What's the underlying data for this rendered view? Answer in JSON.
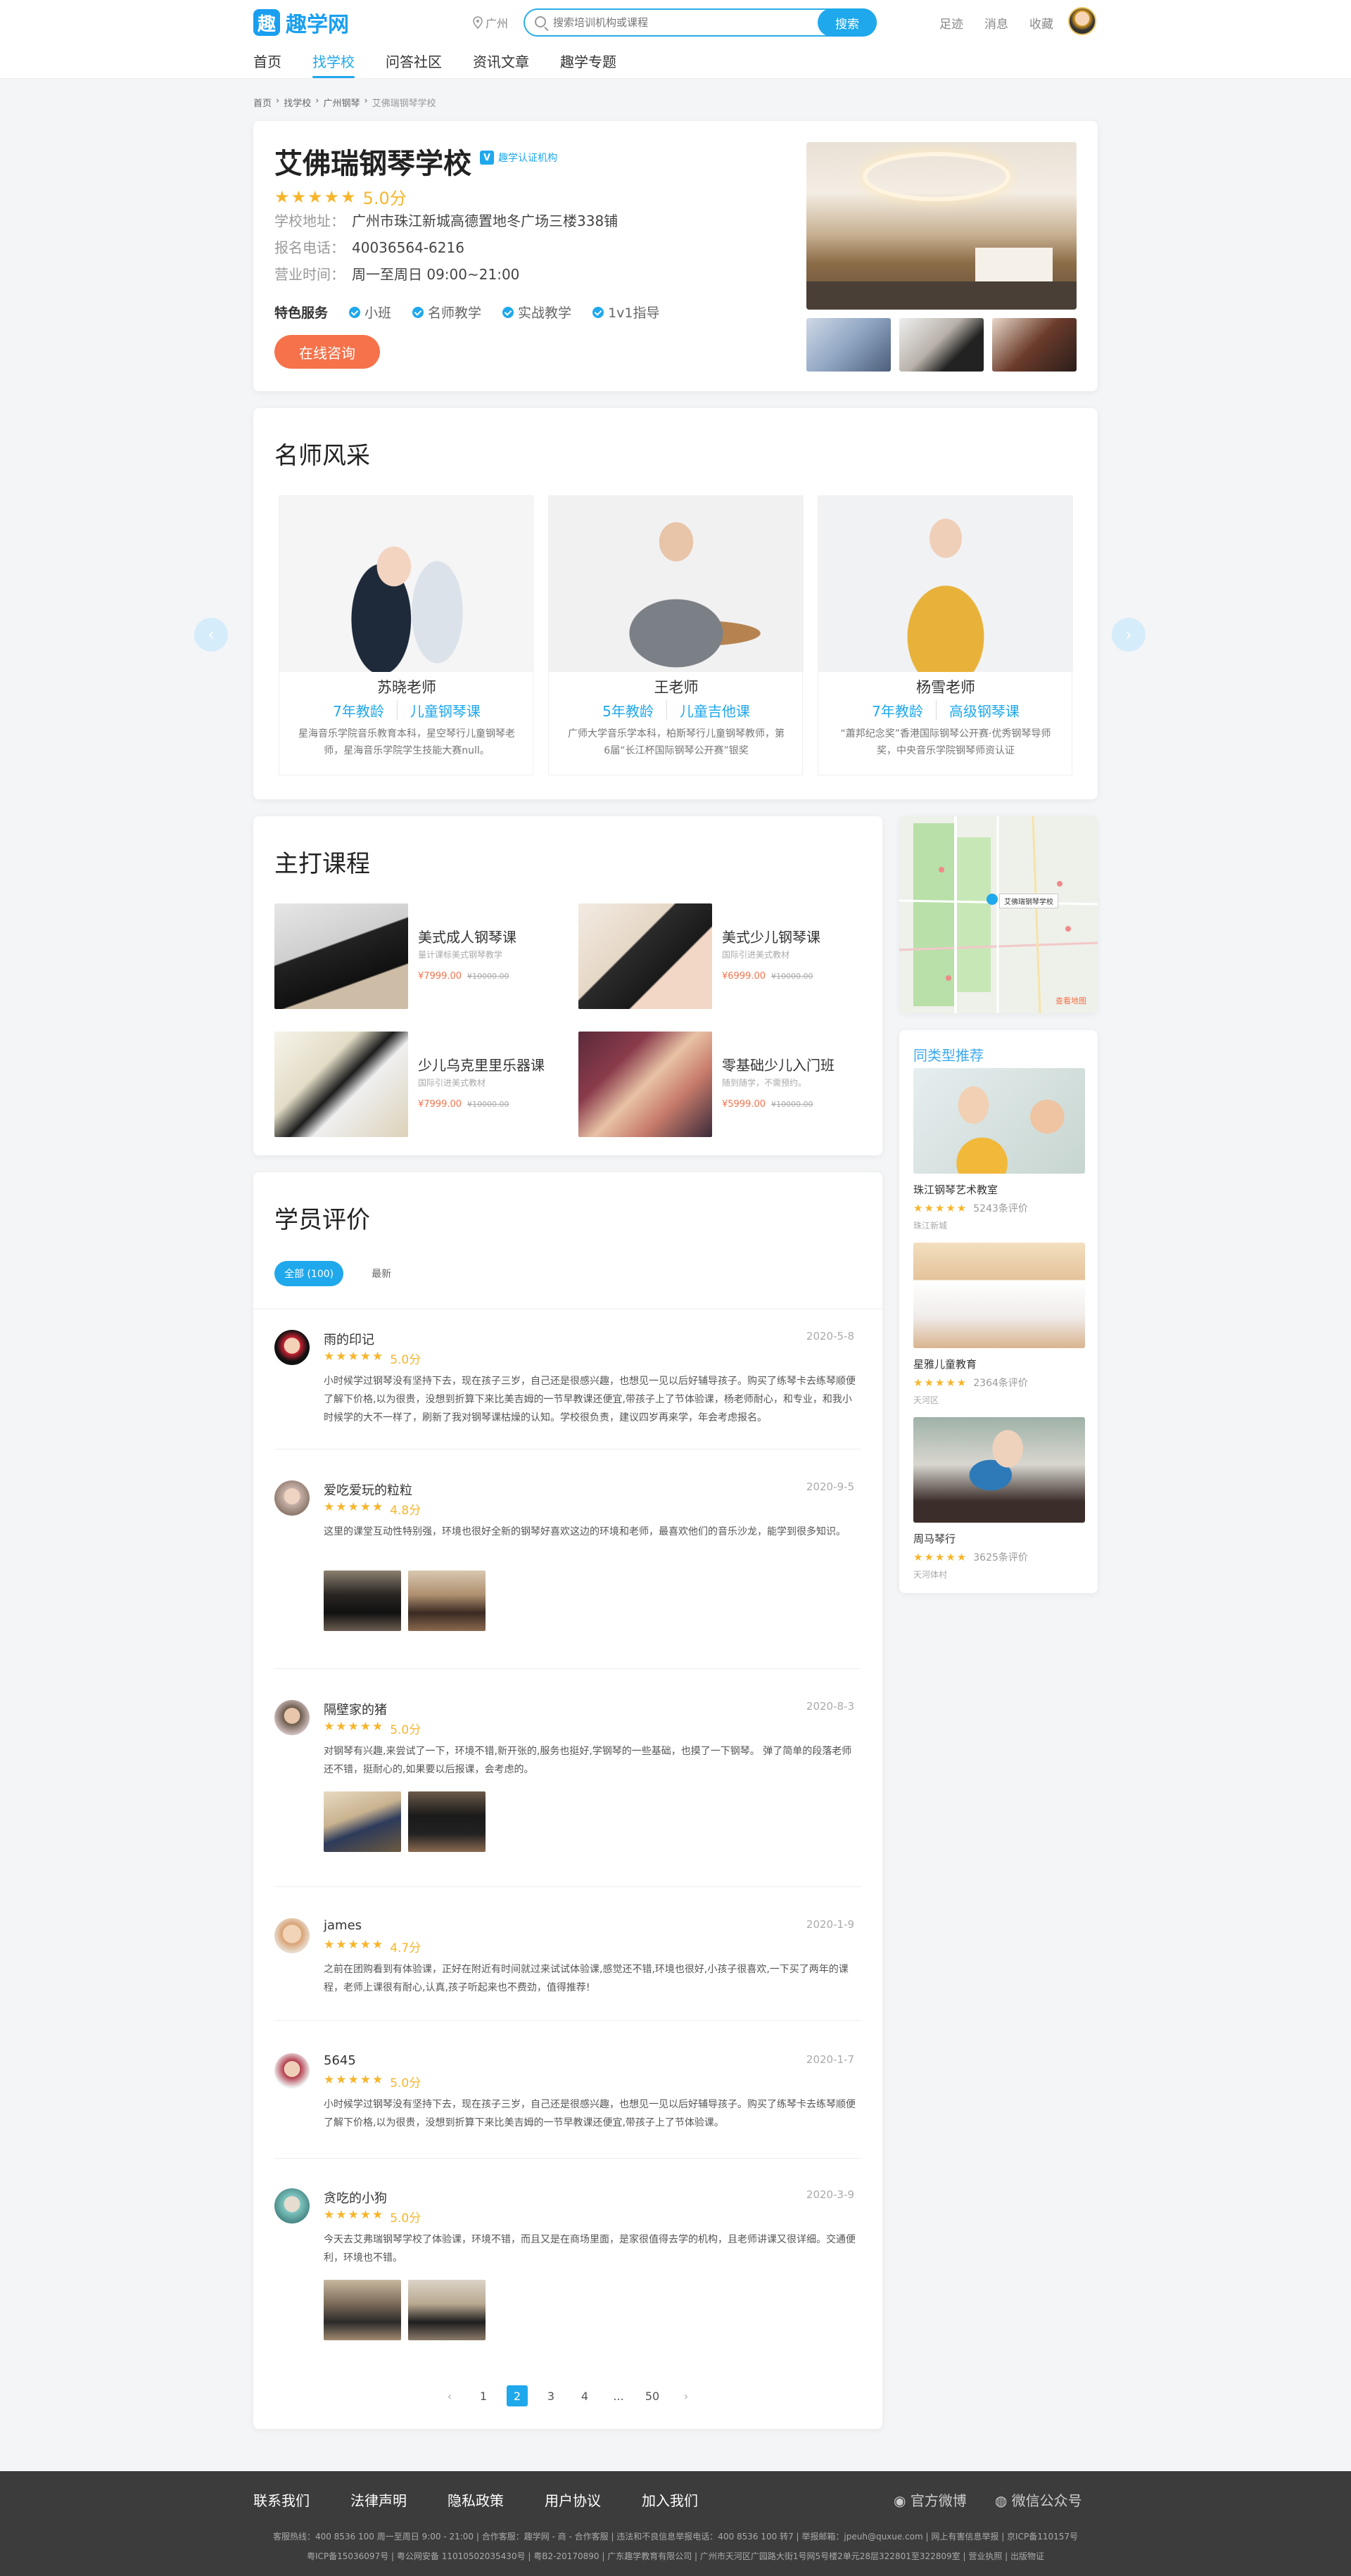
{
  "header": {
    "logo_icon": "趣",
    "logo": "趣学网",
    "city": "广州",
    "search_placeholder": "搜索培训机构或课程",
    "search_btn": "搜索",
    "links": [
      "足迹",
      "消息",
      "收藏"
    ],
    "nav": [
      "首页",
      "找学校",
      "问答社区",
      "资讯文章",
      "趣学专题"
    ]
  },
  "breadcrumb": [
    "首页",
    "找学校",
    "广州钢琴",
    "艾佛瑞钢琴学校"
  ],
  "school": {
    "name": "艾佛瑞钢琴学校",
    "verify_badge": "V",
    "verify": "趣学认证机构",
    "stars": "★★★★★",
    "score": "5.0分",
    "address_label": "学校地址：",
    "address": "广州市珠江新城高德置地冬广场三楼338铺",
    "phone_label": "报名电话：",
    "phone": "40036564-6216",
    "hours_label": "营业时间：",
    "hours": "周一至周日 09:00~21:00",
    "features_label": "特色服务",
    "features": [
      "小班",
      "名师教学",
      "实战教学",
      "1v1指导"
    ],
    "consult": "在线咨询"
  },
  "teachers": {
    "title": "名师风采",
    "items": [
      {
        "name": "苏晓老师",
        "years": "7年教龄",
        "subject": "儿童钢琴课",
        "desc": "星海音乐学院音乐教育本科，星空琴行儿童钢琴老师，星海音乐学院学生技能大赛null。"
      },
      {
        "name": "王老师",
        "years": "5年教龄",
        "subject": "儿童吉他课",
        "desc": "广师大学音乐学本科，柏斯琴行儿童钢琴教师，第6届“长江杯国际钢琴公开赛”银奖"
      },
      {
        "name": "杨雪老师",
        "years": "7年教龄",
        "subject": "高级钢琴课",
        "desc": "“蕭邦纪念奖”香港国际钢琴公开赛·优秀钢琴导师奖，中央音乐学院钢琴师资认证"
      }
    ]
  },
  "courses": {
    "title": "主打课程",
    "items": [
      {
        "title": "美式成人钢琴课",
        "sub": "量计课标美式钢琴教学",
        "price": "¥7999.00",
        "old": "¥10000.00"
      },
      {
        "title": "美式少儿钢琴课",
        "sub": "国际引进美式教材",
        "price": "¥6999.00",
        "old": "¥10000.00"
      },
      {
        "title": "少儿乌克里里乐器课",
        "sub": "国际引进美式教材",
        "price": "¥7999.00",
        "old": "¥10000.00"
      },
      {
        "title": "零基础少儿入门班",
        "sub": "随到随学，不需预约。",
        "price": "¥5999.00",
        "old": "¥10000.00"
      }
    ]
  },
  "map": {
    "label": "艾佛瑞钢琴学校",
    "link": "查看地图"
  },
  "similar": {
    "title": "同类型推荐",
    "items": [
      {
        "name": "珠江钢琴艺术教室",
        "stars": "★★★★★",
        "count": "5243条评价",
        "loc": "珠江新城"
      },
      {
        "name": "星雅儿童教育",
        "stars": "★★★★★",
        "count": "2364条评价",
        "loc": "天河区"
      },
      {
        "name": "周马琴行",
        "stars": "★★★★★",
        "count": "3625条评价",
        "loc": "天河体村"
      }
    ]
  },
  "reviews": {
    "title": "学员评价",
    "tab_all": "全部 (100)",
    "tab_new": "最新",
    "items": [
      {
        "name": "雨的印记",
        "date": "2020-5-8",
        "stars": "★★★★★",
        "score": "5.0分",
        "text": "小时候学过钢琴没有坚持下去，现在孩子三岁，自己还是很感兴趣，也想见一见以后好辅导孩子。购买了练琴卡去练琴顺便了解下价格,以为很贵，没想到折算下来比美吉姆的一节早教课还便宜,带孩子上了节体验课，杨老师耐心，和专业，和我小时候学的大不一样了，刷新了我对钢琴课枯燥的认知。学校很负责，建议四岁再来学，年会考虑报名。"
      },
      {
        "name": "爱吃爱玩的粒粒",
        "date": "2020-9-5",
        "stars": "★★★★★",
        "score": "4.8分",
        "text": "这里的课堂互动性特别强，环境也很好全新的钢琴好喜欢这边的环境和老师，最喜欢他们的音乐沙龙，能学到很多知识。"
      },
      {
        "name": "隔壁家的猪",
        "date": "2020-8-3",
        "stars": "★★★★★",
        "score": "5.0分",
        "text": "对钢琴有兴趣,来尝试了一下，环境不错,新开张的,服务也挺好,学钢琴的一些基础，也摸了一下钢琴。   弹了简单的段落老师还不错，挺耐心的,如果要以后报课，会考虑的。"
      },
      {
        "name": "james",
        "date": "2020-1-9",
        "stars": "★★★★★",
        "score": "4.7分",
        "text": "之前在团购看到有体验课，正好在附近有时间就过来试试体验课,感觉还不错,环境也很好,小孩子很喜欢,一下买了两年的课程，老师上课很有耐心,认真,孩子听起来也不费劲，值得推荐!"
      },
      {
        "name": "5645",
        "date": "2020-1-7",
        "stars": "★★★★★",
        "score": "5.0分",
        "text": "小时候学过钢琴没有坚持下去，现在孩子三岁，自己还是很感兴趣，也想见一见以后好辅导孩子。购买了练琴卡去练琴顺便了解下价格,以为很贵，没想到折算下来比美吉姆的一节早教课还便宜,带孩子上了节体验课。"
      },
      {
        "name": "贪吃的小狗",
        "date": "2020-3-9",
        "stars": "★★★★★",
        "score": "5.0分",
        "text": "今天去艾弗瑞钢琴学校了体验课，环境不错，而且又是在商场里面，是家很值得去学的机构，且老师讲课又很详细。交通便利，环境也不错。"
      }
    ]
  },
  "pagination": {
    "prev": "‹",
    "pages": [
      "1",
      "2",
      "3",
      "4",
      "...",
      "50"
    ],
    "next": "›"
  },
  "footer": {
    "links": [
      "联系我们",
      "法律声明",
      "隐私政策",
      "用户协议",
      "加入我们"
    ],
    "weibo": "官方微博",
    "wechat": "微信公众号",
    "line1": "客服热线：400 8536 100 周一至周日 9:00 - 21:00  |  合作客服：趣学网 - 商 - 合作客服  |  违法和不良信息举报电话：400 8536 100 转7  |  举报邮箱：jpeuh@quxue.com  |  网上有害信息举报  |  京ICP备110157号",
    "line2": "粤ICP备15036097号  |  粤公网安备 11010502035430号  |  粤B2-20170890  |  广东趣学教育有限公司  |  广州市天河区广园路大街1号网5号楼2单元28层322801至322809室  |  营业执照  |  出版物证"
  },
  "colors": {
    "accent": "#1fa8ec",
    "orange": "#f5724a",
    "star": "#f7b52c"
  }
}
